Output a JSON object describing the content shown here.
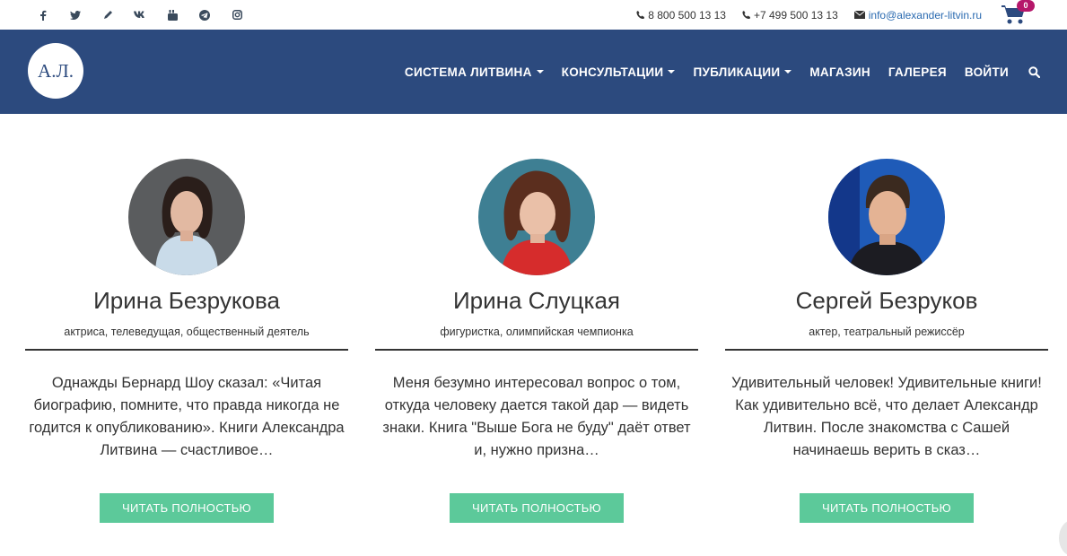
{
  "topbar": {
    "social": [
      {
        "name": "facebook-icon"
      },
      {
        "name": "twitter-icon"
      },
      {
        "name": "livejournal-icon"
      },
      {
        "name": "vk-icon"
      },
      {
        "name": "youtube-icon"
      },
      {
        "name": "telegram-icon"
      },
      {
        "name": "instagram-icon"
      }
    ],
    "phone1": "8 800 500 13 13",
    "phone2": "+7 499 500 13 13",
    "email": "info@alexander-litvin.ru",
    "cart_count": "0"
  },
  "navbar": {
    "logo_text": "А.Л.",
    "items": [
      {
        "label": "СИСТЕМА ЛИТВИНА",
        "dropdown": true
      },
      {
        "label": "КОНСУЛЬТАЦИИ",
        "dropdown": true
      },
      {
        "label": "ПУБЛИКАЦИИ",
        "dropdown": true
      },
      {
        "label": "МАГАЗИН",
        "dropdown": false
      },
      {
        "label": "ГАЛЕРЕЯ",
        "dropdown": false
      },
      {
        "label": "ВОЙТИ",
        "dropdown": false
      }
    ]
  },
  "testimonials": [
    {
      "name": "Ирина Безрукова",
      "role": "актриса, телеведущая, общественный деятель",
      "quote": "Однажды Бернард Шоу сказал: «Читая биографию, помните, что правда никогда не годится к опубликованию». Книги Александра Литвина — счастливое…",
      "button": "ЧИТАТЬ ПОЛНОСТЬЮ"
    },
    {
      "name": "Ирина Слуцкая",
      "role": "фигуристка, олимпийская чемпионка",
      "quote": "Меня безумно интересовал вопрос о том, откуда человеку дается такой дар — видеть знаки. Книга \"Выше Бога не буду\" даёт ответ и, нужно призна…",
      "button": "ЧИТАТЬ ПОЛНОСТЬЮ"
    },
    {
      "name": "Сергей Безруков",
      "role": "актер, театральный режиссёр",
      "quote": "Удивительный человек! Удивительные книги! Как удивительно всё, что делает Александр Литвин. После знакомства с Сашей начинаешь верить в сказ…",
      "button": "ЧИТАТЬ ПОЛНОСТЬЮ"
    }
  ],
  "colors": {
    "navbar": "#2c4a7e",
    "button": "#5cc99a",
    "badge": "#b5176a",
    "email": "#2a6ab0"
  }
}
